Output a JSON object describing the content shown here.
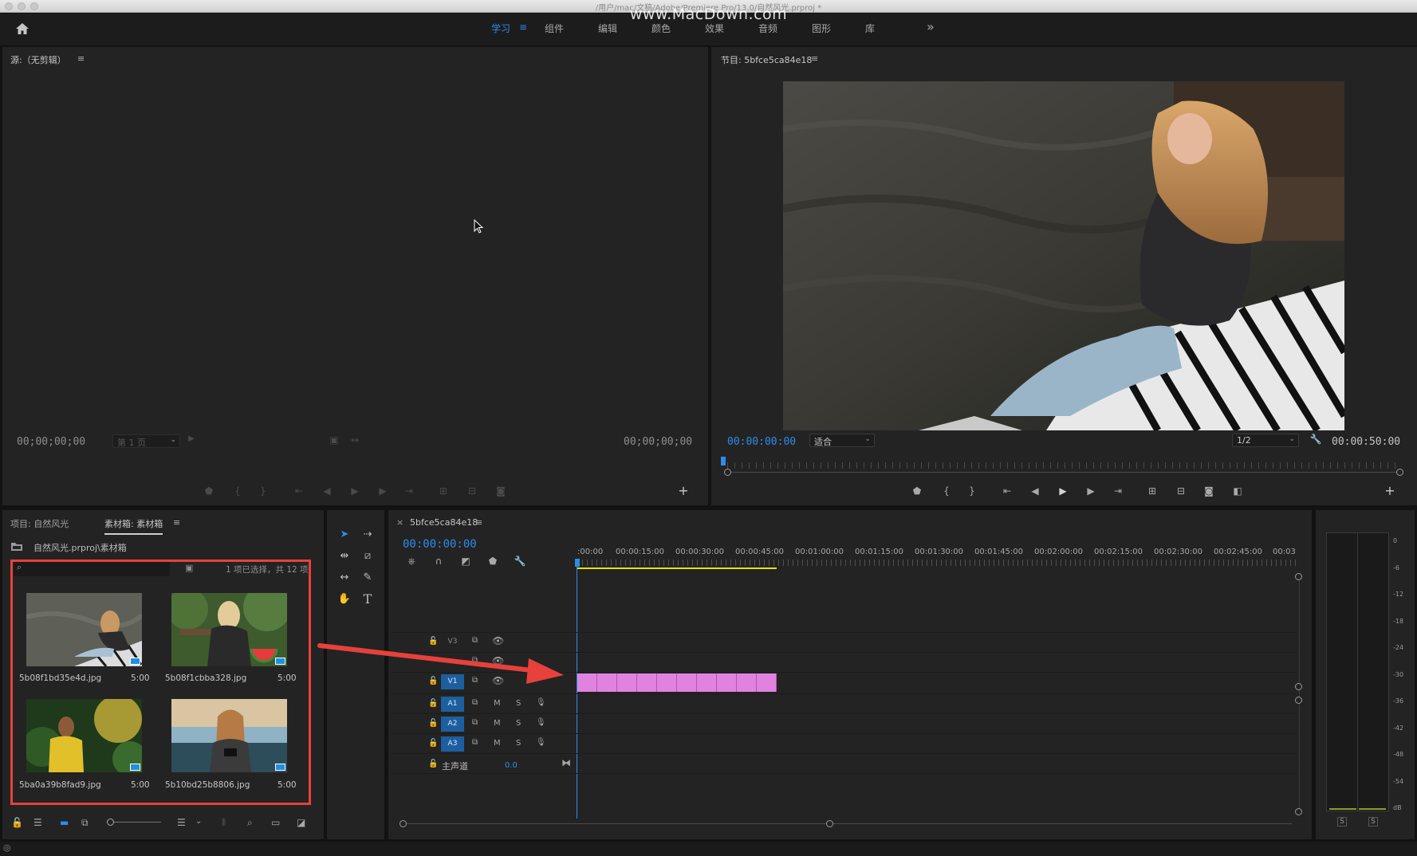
{
  "window": {
    "title": "/用户/mac/文稿/Adobe/Premiere Pro/13.0/自然风光.prproj *",
    "watermark": "www.MacDown.com"
  },
  "workspaces": [
    {
      "label": "学习",
      "active": true
    },
    {
      "label": "组件"
    },
    {
      "label": "编辑"
    },
    {
      "label": "颜色"
    },
    {
      "label": "效果"
    },
    {
      "label": "音频"
    },
    {
      "label": "图形"
    },
    {
      "label": "库"
    }
  ],
  "workspace_menu_glyph": "≡",
  "workspace_overflow": "»",
  "source_monitor": {
    "title": "源:（无剪辑）",
    "menu_glyph": "≡",
    "timecode_left": "00;00;00;00",
    "page_select": "第 1 页",
    "timecode_right": "00;00;00;00"
  },
  "program_monitor": {
    "title": "节目: 5bfce5ca84e18",
    "menu_glyph": "≡",
    "timecode": "00:00:00:00",
    "zoom": "适合",
    "resolution": "1/2",
    "duration": "00:00:50:00"
  },
  "project_panel": {
    "tab_project": "项目: 自然风光",
    "tab_bin": "素材箱: 素材箱",
    "menu_glyph": "≡",
    "path": "自然风光.prproj\\素材箱",
    "selection_info": "1 项已选择，共 12 项",
    "items": [
      {
        "name": "5b08f1bd35e4d.jpg",
        "duration": "5:00"
      },
      {
        "name": "5b08f1cbba328.jpg",
        "duration": "5:00"
      },
      {
        "name": "5ba0a39b8fad9.jpg",
        "duration": "5:00"
      },
      {
        "name": "5b10bd25b8806.jpg",
        "duration": "5:00"
      }
    ]
  },
  "timeline": {
    "tab": "5bfce5ca84e18",
    "close_glyph": "×",
    "menu_glyph": "≡",
    "timecode": "00:00:00:00",
    "ruler": [
      ":00:00",
      "00:00:15:00",
      "00:00:30:00",
      "00:00:45:00",
      "00:01:00:00",
      "00:01:15:00",
      "00:01:30:00",
      "00:01:45:00",
      "00:02:00:00",
      "00:02:15:00",
      "00:02:30:00",
      "00:02:45:00",
      "00:03"
    ],
    "video_tracks": [
      "V3",
      "V2",
      "V1"
    ],
    "audio_tracks": [
      "A1",
      "A2",
      "A3"
    ],
    "track_mute": "M",
    "track_solo": "S",
    "master_label": "主声道",
    "master_value": "0.0",
    "clip_count": 10
  },
  "audio_meter": {
    "scale": [
      "0",
      "-6",
      "-12",
      "-18",
      "-24",
      "-30",
      "-36",
      "-42",
      "-48",
      "-54",
      "dB"
    ],
    "solo_labels": [
      "S",
      "S"
    ]
  },
  "colors": {
    "accent_blue": "#2d8ceb",
    "clip_pink": "#e083e0",
    "annotation_red": "#e8413b",
    "work_area_yellow": "#e6e600"
  }
}
